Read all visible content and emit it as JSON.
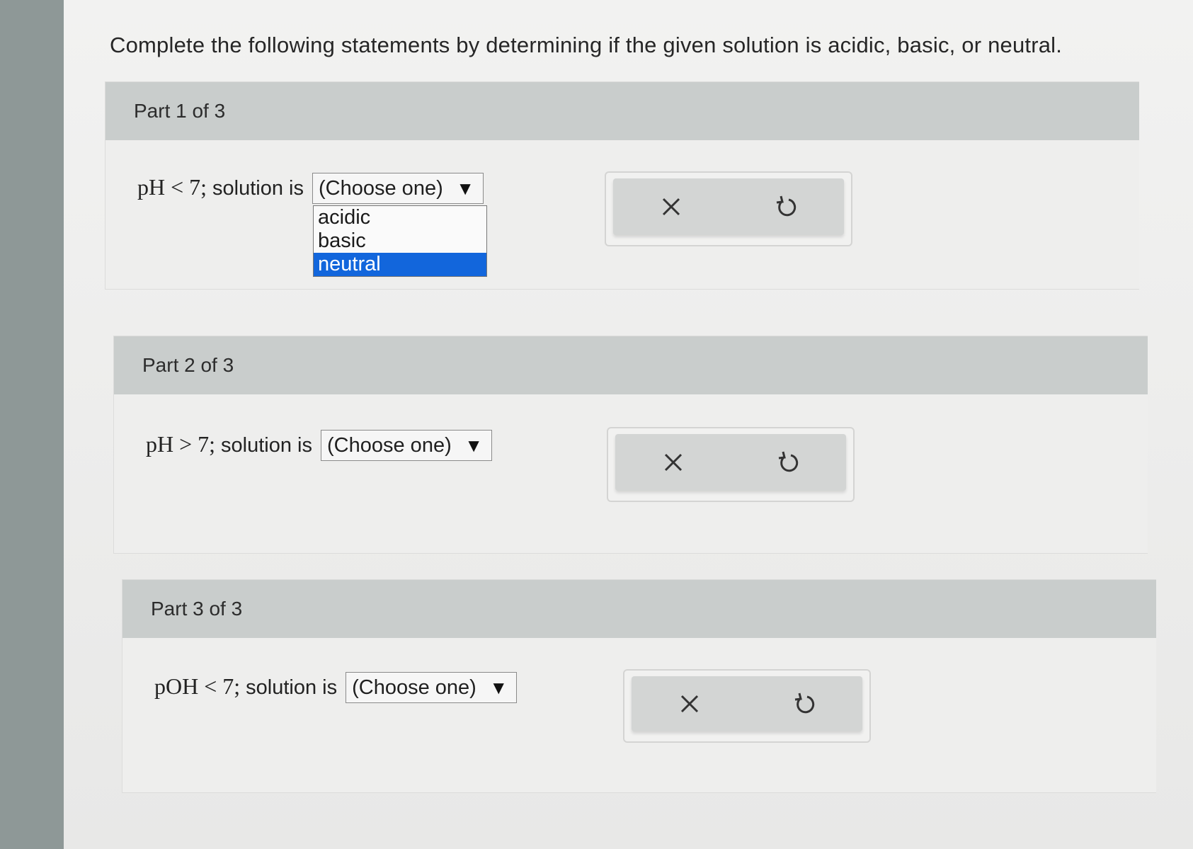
{
  "instructions": "Complete the following statements by determining if the given solution is acidic, basic, or neutral.",
  "parts": [
    {
      "header": "Part 1 of 3",
      "math": "pH < 7;",
      "text": "solution is",
      "select": {
        "value": "(Choose one)",
        "caret": "▼",
        "open": true,
        "options": [
          "acidic",
          "basic",
          "neutral"
        ],
        "highlighted": "neutral"
      },
      "icons": {
        "clear": "close-icon",
        "reset": "undo-icon"
      }
    },
    {
      "header": "Part 2 of 3",
      "math": "pH > 7;",
      "text": "solution is",
      "select": {
        "value": "(Choose one)",
        "caret": "▼",
        "open": false
      },
      "icons": {
        "clear": "close-icon",
        "reset": "undo-icon"
      }
    },
    {
      "header": "Part 3 of 3",
      "math": "pOH < 7;",
      "text": "solution is",
      "select": {
        "value": "(Choose one)",
        "caret": "▼",
        "open": false
      },
      "icons": {
        "clear": "close-icon",
        "reset": "undo-icon"
      }
    }
  ],
  "colors": {
    "header_bg": "#c9cdcc",
    "highlight": "#1266dc"
  }
}
